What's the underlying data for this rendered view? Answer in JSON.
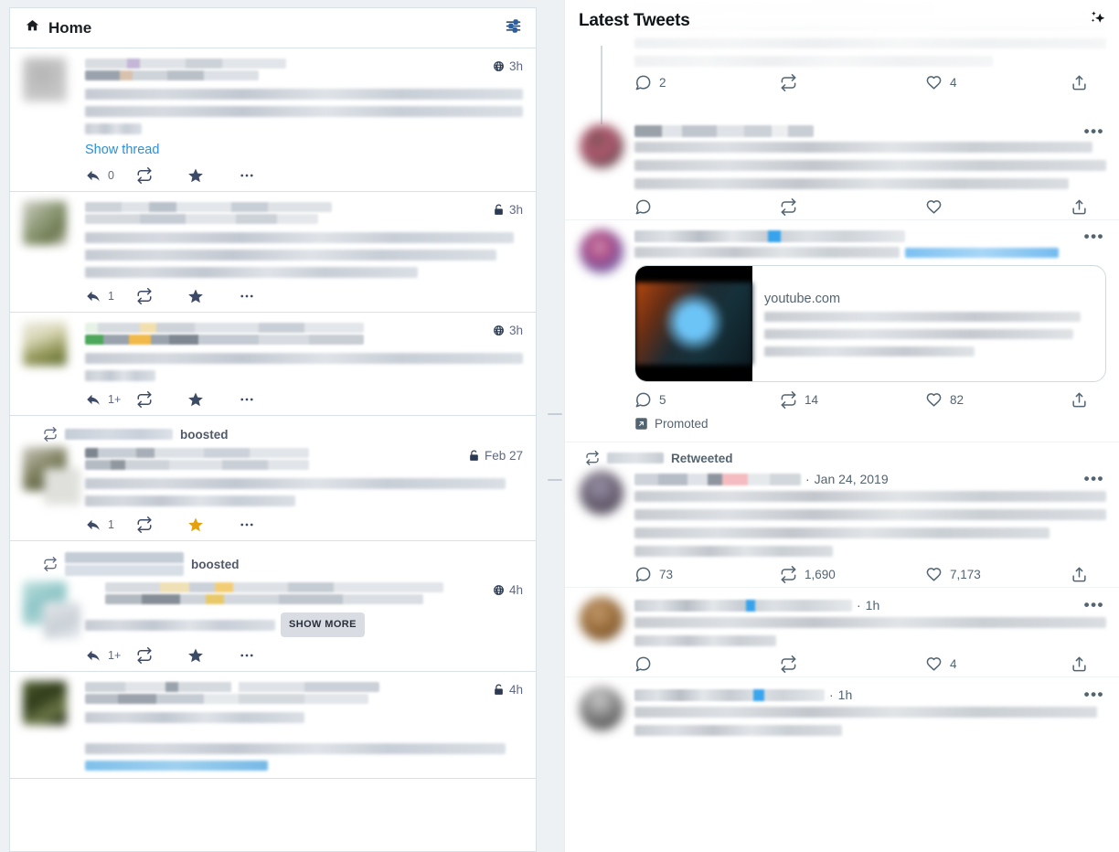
{
  "left_panel": {
    "header": {
      "title": "Home",
      "home_icon": "home-icon",
      "settings_icon": "sliders-icon"
    },
    "statuses": [
      {
        "id": "status-1",
        "visibility_icon": "globe-icon",
        "time": "3h",
        "show_thread_label": "Show thread",
        "content_lines": 3,
        "actions": {
          "reply_count": "0",
          "boost_count": "",
          "favourited": false
        }
      },
      {
        "id": "status-2",
        "visibility_icon": "unlock-icon",
        "time": "3h",
        "content_lines": 3,
        "actions": {
          "reply_count": "1",
          "boost_count": "",
          "favourited": false
        }
      },
      {
        "id": "status-3",
        "visibility_icon": "globe-icon",
        "time": "3h",
        "content_lines": 2,
        "actions": {
          "reply_count": "1+",
          "boost_count": "",
          "favourited": false
        }
      },
      {
        "id": "status-4",
        "boost_label": "boosted",
        "visibility_icon": "unlock-icon",
        "time": "Feb 27",
        "content_lines": 2,
        "actions": {
          "reply_count": "1",
          "boost_count": "",
          "favourited": true
        }
      },
      {
        "id": "status-5",
        "boost_label": "boosted",
        "visibility_icon": "globe-icon",
        "time": "4h",
        "show_more_label": "SHOW MORE",
        "content_lines": 1,
        "actions": {
          "reply_count": "1+",
          "boost_count": "",
          "favourited": false
        }
      },
      {
        "id": "status-6",
        "visibility_icon": "unlock-icon",
        "time": "4h",
        "content_lines": 3,
        "actions": {
          "reply_count": "",
          "boost_count": "",
          "favourited": false
        }
      }
    ]
  },
  "right_panel": {
    "header": {
      "title": "Latest Tweets",
      "sparkle_icon": "sparkle-icon"
    },
    "tweets": [
      {
        "id": "tweet-0",
        "faded": true,
        "actions": {
          "reply": "2",
          "retweet": "",
          "like": "4",
          "share": ""
        }
      },
      {
        "id": "tweet-1",
        "thread_connector": true,
        "actions": {
          "reply": "",
          "retweet": "",
          "like": "",
          "share": ""
        }
      },
      {
        "id": "tweet-2",
        "has_card": true,
        "card": {
          "domain": "youtube.com",
          "title_lines": 3
        },
        "promoted_label": "Promoted",
        "promoted_icon": "external-link-icon",
        "actions": {
          "reply": "5",
          "retweet": "14",
          "like": "82",
          "share": ""
        }
      },
      {
        "id": "tweet-3",
        "retweeted_by_label": "Retweeted",
        "retweet_header_icon": "retweet-icon",
        "time": "Jan 24, 2019",
        "separator_dot": "·",
        "content_lines": 4,
        "actions": {
          "reply": "73",
          "retweet": "1,690",
          "like": "7,173",
          "share": ""
        }
      },
      {
        "id": "tweet-4",
        "time": "1h",
        "separator_dot": "·",
        "content_lines": 2,
        "actions": {
          "reply": "",
          "retweet": "",
          "like": "4",
          "share": ""
        }
      },
      {
        "id": "tweet-5",
        "time": "1h",
        "separator_dot": "·",
        "content_lines": 2,
        "actions": {
          "reply": "",
          "retweet": "",
          "like": "",
          "share": ""
        }
      }
    ],
    "icons": {
      "reply": "reply-bubble-icon",
      "retweet": "retweet-icon",
      "like": "heart-icon",
      "share": "share-icon",
      "more": "more-horizontal-icon"
    }
  },
  "colors": {
    "mastodon_link": "#2b90d9",
    "mastodon_icon": "#3d4a66",
    "favourite_gold": "#ca8f04",
    "twitter_muted": "#536471",
    "twitter_blue": "#1d9bf0",
    "panel_border": "#d9e1e8",
    "page_bg": "#eef1f4"
  }
}
